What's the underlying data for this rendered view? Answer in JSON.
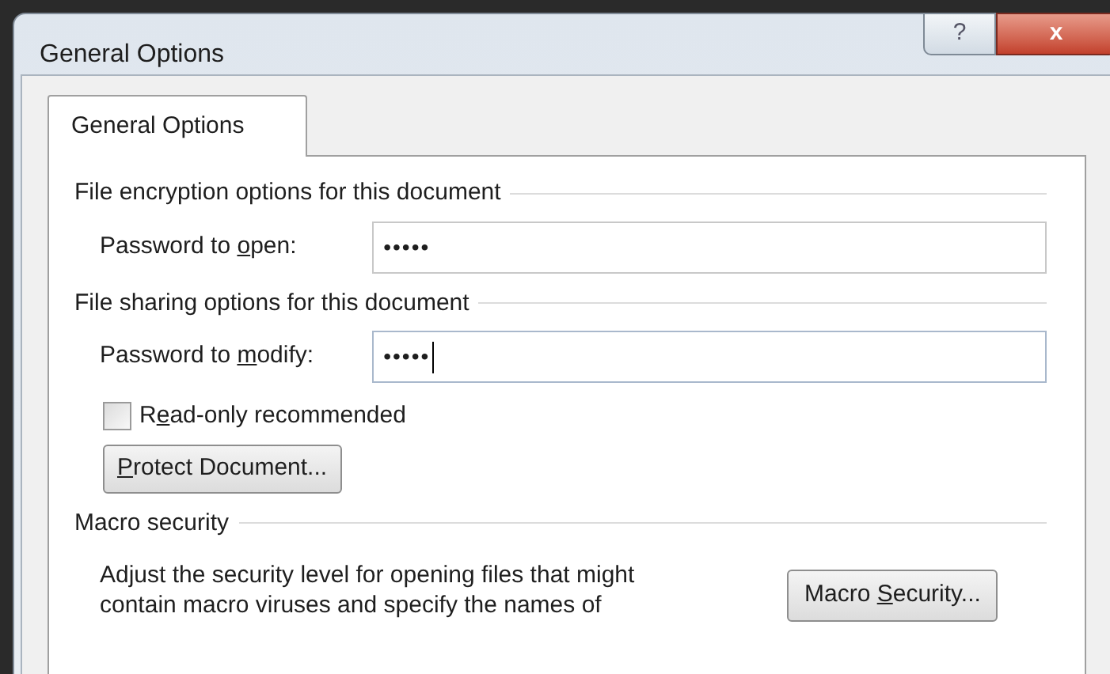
{
  "window": {
    "title": "General Options",
    "help_symbol": "?",
    "close_symbol": "x"
  },
  "tabs": [
    {
      "label": "General Options",
      "selected": true
    }
  ],
  "sections": [
    {
      "title": "File encryption options for this document",
      "items": [
        {
          "kind": "password",
          "label": [
            {
              "text": "Password to ",
              "underlined": false
            },
            {
              "text": "o",
              "underlined": true
            },
            {
              "text": "pen:",
              "underlined": false
            }
          ],
          "value": "•••••",
          "focused": false
        }
      ]
    },
    {
      "title": "File sharing options for this document",
      "items": [
        {
          "kind": "password",
          "label": [
            {
              "text": "Password to ",
              "underlined": false
            },
            {
              "text": "m",
              "underlined": true
            },
            {
              "text": "odify:",
              "underlined": false
            }
          ],
          "value": "•••••",
          "focused": true
        },
        {
          "kind": "checkbox",
          "label": [
            {
              "text": "R",
              "underlined": false
            },
            {
              "text": "e",
              "underlined": true
            },
            {
              "text": "ad-only recommended",
              "underlined": false
            }
          ],
          "checked": false
        },
        {
          "kind": "button",
          "label": [
            {
              "text": "P",
              "underlined": true
            },
            {
              "text": "rotect Document...",
              "underlined": false
            }
          ]
        }
      ]
    },
    {
      "title": "Macro security",
      "items": [
        {
          "kind": "description",
          "text": "Adjust the security level for opening files that might\ncontain macro viruses and specify the names of",
          "button": {
            "label": [
              {
                "text": "Macro ",
                "underlined": false
              },
              {
                "text": "S",
                "underlined": true
              },
              {
                "text": "ecurity...",
                "underlined": false
              }
            ]
          }
        }
      ]
    }
  ]
}
